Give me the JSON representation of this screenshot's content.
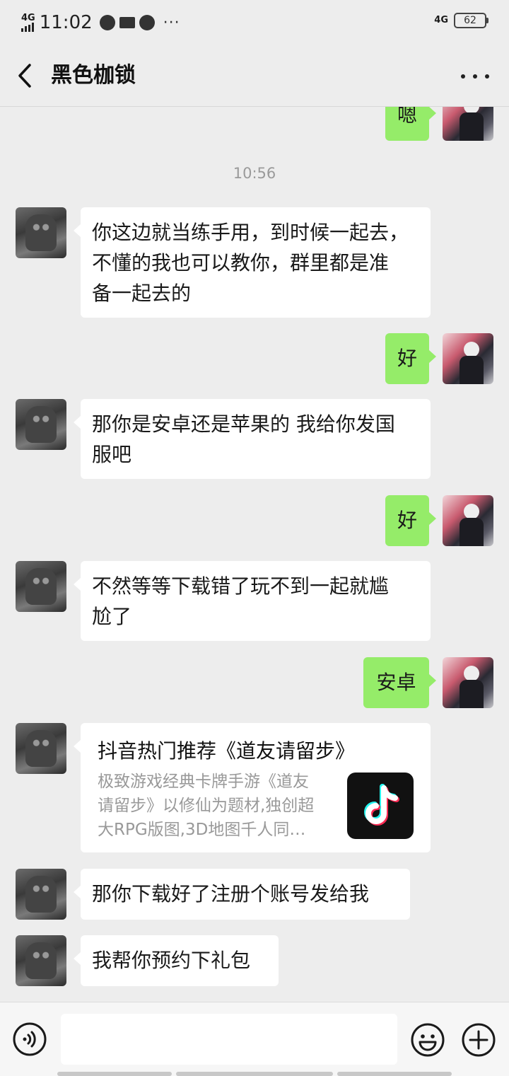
{
  "status_bar": {
    "network_left": "4G",
    "time": "11:02",
    "more": "···",
    "network_right": "4G",
    "battery": "62"
  },
  "title_bar": {
    "title": "黑色枷锁"
  },
  "chat": {
    "timestamp": "10:56",
    "messages": [
      {
        "side": "out",
        "text": "嗯"
      },
      {
        "side": "in",
        "lines": [
          "你这边就当练手用，到时候一起去，",
          "不懂的我也可以教你，群里都是准",
          "备一起去的"
        ]
      },
      {
        "side": "out",
        "text": "好"
      },
      {
        "side": "in",
        "lines": [
          "那你是安卓还是苹果的 我给你发国",
          "服吧"
        ]
      },
      {
        "side": "out",
        "text": "好"
      },
      {
        "side": "in",
        "lines": [
          "不然等等下载错了玩不到一起就尴",
          "尬了"
        ]
      },
      {
        "side": "out",
        "text": "安卓"
      },
      {
        "side": "in",
        "card": {
          "title": "抖音热门推荐《道友请留步》",
          "desc_lines": [
            "极致游戏经典卡牌手游《道友",
            "请留步》以修仙为题材,独创超",
            "大RPG版图,3D地图千人同…"
          ],
          "icon": "tiktok-icon"
        }
      },
      {
        "side": "in",
        "text": "那你下载好了注册个账号发给我"
      },
      {
        "side": "in",
        "text": "我帮你预约下礼包"
      }
    ]
  },
  "input_bar": {
    "voice_icon": "voice-icon",
    "emoji_icon": "emoji-icon",
    "plus_icon": "plus-icon",
    "value": ""
  },
  "colors": {
    "background": "#ededed",
    "outgoing_bubble": "#95ec69",
    "incoming_bubble": "#ffffff"
  }
}
